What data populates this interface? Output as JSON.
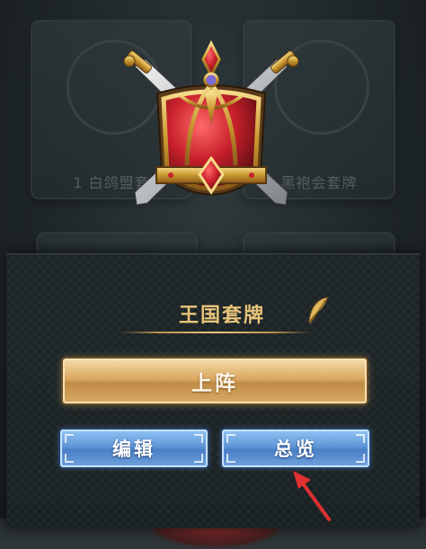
{
  "background": {
    "left_card_label": "1 白鸽盟套",
    "right_card_label": "黑袍会套牌"
  },
  "panel": {
    "deck_name": "王国套牌",
    "deploy_label": "上阵",
    "edit_label": "编辑",
    "overview_label": "总览"
  },
  "icons": {
    "emblem": "kingdom-crest-icon",
    "edit_name": "feather-quill-icon",
    "pointer": "red-arrow-icon"
  },
  "colors": {
    "title_gold": "#e7c47a",
    "deploy_gold": "#d9a862",
    "button_blue": "#5f95d8",
    "arrow_red": "#e03030"
  }
}
